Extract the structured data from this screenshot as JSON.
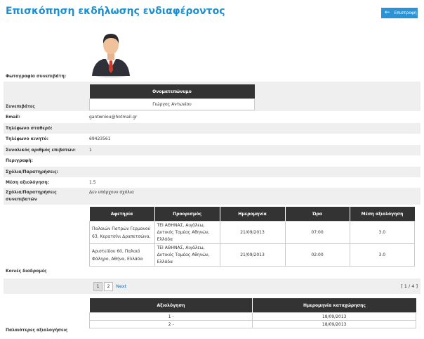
{
  "page": {
    "title": "Επισκόπηση εκδήλωσης ενδιαφέροντος",
    "back_label": "Επιστροφή"
  },
  "labels": {
    "photo": "Φωτογραφία συνεπιβάτη:",
    "passengers": "Συνεπιβάτες",
    "email": "Email:",
    "landline": "Τηλέφωνο σταθερό:",
    "mobile": "Τηλέφωνο κινητό:",
    "total": "Συνολικός αριθμός επιβατών:",
    "description": "Περιγραφή:",
    "comments": "Σχόλια/Παρατηρήσεις:",
    "rating": "Μέση αξιολόγηση:",
    "passenger_comments_1": "Σχόλια/Παρατηρήσεις",
    "passenger_comments_2": "συνεπιβατών",
    "common_routes": "Κοινές διαδρομές",
    "old_ratings": "Παλαιότερες αξιολογήσεις"
  },
  "values": {
    "email": "gantwniou@hotmail.gr",
    "landline": "",
    "mobile": "69423561",
    "total": "1",
    "description": "",
    "comments": "",
    "rating": "1.5",
    "passenger_comments": "Δεν υπάρχουν σχόλια"
  },
  "passengers_table": {
    "header": "Ονοματεπώνυμο",
    "rows": [
      "Γιώργος Αντωνίου"
    ]
  },
  "routes_table": {
    "headers": [
      "Αφετηρία",
      "Προορισμός",
      "Ημερομηνία",
      "Ώρα",
      "Μέση αξιολόγηση"
    ],
    "rows": [
      {
        "start_1": "Παλαιών Πατρών Γερμανού",
        "start_2": "63, Κερατσίνι Δραπετσώνα,",
        "dest_1": "ΤΕΙ ΑΘΗΝΑΣ, Αιγάλεω,",
        "dest_2": "Δυτικός Τομέας Αθηνών,",
        "dest_3": "Ελλάδα",
        "date": "21/09/2013",
        "time": "07:00",
        "rating": "3.0"
      },
      {
        "start_1": "Αριστείδου 60, Παλαιό",
        "start_2": "Φάληρο, Αθήνα, Ελλάδα",
        "dest_1": "ΤΕΙ ΑΘΗΝΑΣ, Αιγάλεω,",
        "dest_2": "Δυτικός Τομέας Αθηνών,",
        "dest_3": "Ελλάδα",
        "date": "21/09/2013",
        "time": "02:00",
        "rating": "3.0"
      }
    ]
  },
  "pagination": {
    "pages": [
      "1",
      "2"
    ],
    "next": "Next",
    "counter": "[ 1 / 4 ]"
  },
  "ratings_table": {
    "headers": [
      "Αξιολόγηση",
      "Ημερομηνία καταχώρησης"
    ],
    "rows": [
      {
        "rating": "1 -",
        "date": "18/09/2013"
      },
      {
        "rating": "2 -",
        "date": "18/09/2013"
      }
    ]
  },
  "colors": {
    "accent": "#1b8fd0",
    "header_bg": "#333333",
    "row_shade": "#efefef"
  }
}
